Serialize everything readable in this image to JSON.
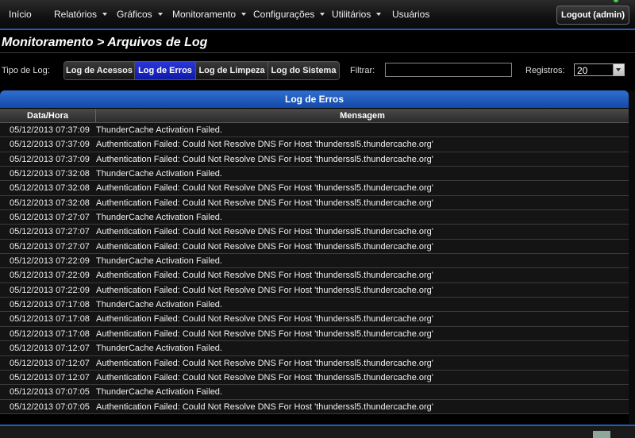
{
  "nav": {
    "items": [
      {
        "label": "Início",
        "dropdown": false
      },
      {
        "label": "Relatórios",
        "dropdown": true
      },
      {
        "label": "Gráficos",
        "dropdown": true
      },
      {
        "label": "Monitoramento",
        "dropdown": true
      },
      {
        "label": "Configurações",
        "dropdown": true
      },
      {
        "label": "Utilitários",
        "dropdown": true
      },
      {
        "label": "Usuários",
        "dropdown": false
      }
    ],
    "logout": "Logout (admin)"
  },
  "page": {
    "title": "Monitoramento > Arquivos de Log"
  },
  "controls": {
    "log_type_label": "Tipo de Log:",
    "log_types": [
      "Log de Acessos",
      "Log de Erros",
      "Log de Limpeza",
      "Log do Sistema"
    ],
    "active_log_type": "Log de Erros",
    "filter_label": "Filtrar:",
    "filter_value": "",
    "records_label": "Registros:",
    "records_value": "20"
  },
  "panel": {
    "title": "Log de Erros",
    "columns": [
      "Data/Hora",
      "Mensagem"
    ],
    "rows": [
      {
        "date": "05/12/2013 07:37:09",
        "msg": "ThunderCache Activation Failed."
      },
      {
        "date": "05/12/2013 07:37:09",
        "msg": "Authentication Failed: Could Not Resolve DNS For Host 'thunderssl5.thundercache.org'"
      },
      {
        "date": "05/12/2013 07:37:09",
        "msg": "Authentication Failed: Could Not Resolve DNS For Host 'thunderssl5.thundercache.org'"
      },
      {
        "date": "05/12/2013 07:32:08",
        "msg": "ThunderCache Activation Failed."
      },
      {
        "date": "05/12/2013 07:32:08",
        "msg": "Authentication Failed: Could Not Resolve DNS For Host 'thunderssl5.thundercache.org'"
      },
      {
        "date": "05/12/2013 07:32:08",
        "msg": "Authentication Failed: Could Not Resolve DNS For Host 'thunderssl5.thundercache.org'"
      },
      {
        "date": "05/12/2013 07:27:07",
        "msg": "ThunderCache Activation Failed."
      },
      {
        "date": "05/12/2013 07:27:07",
        "msg": "Authentication Failed: Could Not Resolve DNS For Host 'thunderssl5.thundercache.org'"
      },
      {
        "date": "05/12/2013 07:27:07",
        "msg": "Authentication Failed: Could Not Resolve DNS For Host 'thunderssl5.thundercache.org'"
      },
      {
        "date": "05/12/2013 07:22:09",
        "msg": "ThunderCache Activation Failed."
      },
      {
        "date": "05/12/2013 07:22:09",
        "msg": "Authentication Failed: Could Not Resolve DNS For Host 'thunderssl5.thundercache.org'"
      },
      {
        "date": "05/12/2013 07:22:09",
        "msg": "Authentication Failed: Could Not Resolve DNS For Host 'thunderssl5.thundercache.org'"
      },
      {
        "date": "05/12/2013 07:17:08",
        "msg": "ThunderCache Activation Failed."
      },
      {
        "date": "05/12/2013 07:17:08",
        "msg": "Authentication Failed: Could Not Resolve DNS For Host 'thunderssl5.thundercache.org'"
      },
      {
        "date": "05/12/2013 07:17:08",
        "msg": "Authentication Failed: Could Not Resolve DNS For Host 'thunderssl5.thundercache.org'"
      },
      {
        "date": "05/12/2013 07:12:07",
        "msg": "ThunderCache Activation Failed."
      },
      {
        "date": "05/12/2013 07:12:07",
        "msg": "Authentication Failed: Could Not Resolve DNS For Host 'thunderssl5.thundercache.org'"
      },
      {
        "date": "05/12/2013 07:12:07",
        "msg": "Authentication Failed: Could Not Resolve DNS For Host 'thunderssl5.thundercache.org'"
      },
      {
        "date": "05/12/2013 07:07:05",
        "msg": "ThunderCache Activation Failed."
      },
      {
        "date": "05/12/2013 07:07:05",
        "msg": "Authentication Failed: Could Not Resolve DNS For Host 'thunderssl5.thundercache.org'"
      }
    ]
  },
  "colors": {
    "accent": "#1f5db8",
    "active_button": "#1a25c8",
    "panel_header": "#2460c0"
  }
}
